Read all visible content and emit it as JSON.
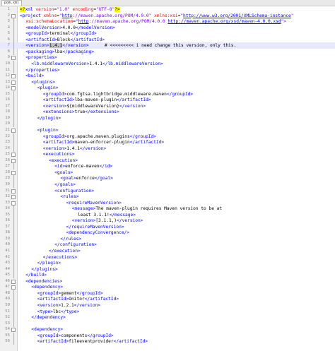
{
  "tab": {
    "label": "pom.xml"
  },
  "lines": [
    {
      "n": "1",
      "indent": 0,
      "fold": "none",
      "parts": [
        [
          "decl",
          "<?"
        ],
        [
          "t",
          "xml"
        ],
        [
          "a",
          " version"
        ],
        [
          "c",
          "="
        ],
        [
          "v",
          "\"1.0\""
        ],
        [
          "a",
          " encoding"
        ],
        [
          "c",
          "="
        ],
        [
          "v",
          "\"UTF-8\""
        ],
        [
          "decl",
          "?>"
        ]
      ]
    },
    {
      "n": "2",
      "indent": 0,
      "fold": "box",
      "parts": [
        [
          "t",
          "<project"
        ],
        [
          "a",
          " xmlns"
        ],
        [
          "c",
          "="
        ],
        [
          "v",
          "\""
        ],
        [
          "u",
          "http"
        ],
        [
          "v",
          "://maven.apache.org/POM/4.0.0\""
        ],
        [
          "a",
          " xmlns:xsi"
        ],
        [
          "c",
          "="
        ],
        [
          "v",
          "\""
        ],
        [
          "u",
          "http://www.w3.org/2001/XMLSchema-instance"
        ],
        [
          "v",
          "\""
        ]
      ]
    },
    {
      "n": "3",
      "indent": 1,
      "fold": "vl",
      "parts": [
        [
          "a",
          "xsi:schemaLocation"
        ],
        [
          "c",
          "="
        ],
        [
          "v",
          "\""
        ],
        [
          "u",
          "http"
        ],
        [
          "v",
          "://maven.apache.org/POM/4.0.0 "
        ],
        [
          "u",
          "http://maven.apache.org/xsd/maven-4.0.0.xsd"
        ],
        [
          "v",
          "\">"
        ]
      ]
    },
    {
      "n": "4",
      "indent": 1,
      "fold": "vl",
      "parts": [
        [
          "t",
          "<modelVersion>"
        ],
        [
          "c",
          "4.0.0"
        ],
        [
          "t",
          "</modelVersion>"
        ]
      ]
    },
    {
      "n": "5",
      "indent": 1,
      "fold": "vl",
      "parts": [
        [
          "t",
          "<groupId>"
        ],
        [
          "c",
          "terminal"
        ],
        [
          "t",
          "</groupId>"
        ]
      ]
    },
    {
      "n": "6",
      "indent": 1,
      "fold": "vl",
      "parts": [
        [
          "t",
          "<artifactId>"
        ],
        [
          "c",
          "Block"
        ],
        [
          "t",
          "</artifactId>"
        ]
      ]
    },
    {
      "n": "7",
      "indent": 1,
      "fold": "vl",
      "hl": true,
      "parts": [
        [
          "t",
          "<version>"
        ],
        [
          "sel",
          "1.4.1"
        ],
        [
          "t",
          "</version>"
        ],
        [
          "c",
          "      # <<<<<<<<< i need change this version, only this."
        ]
      ]
    },
    {
      "n": "8",
      "indent": 1,
      "fold": "vl",
      "parts": [
        [
          "t",
          "<packaging>"
        ],
        [
          "c",
          "lba"
        ],
        [
          "t",
          "</packaging>"
        ]
      ]
    },
    {
      "n": "9",
      "indent": 1,
      "fold": "box",
      "parts": [
        [
          "t",
          "<properties>"
        ]
      ]
    },
    {
      "n": "10",
      "indent": 2,
      "fold": "vl",
      "parts": [
        [
          "t",
          "<lb.middlewareVersion>"
        ],
        [
          "c",
          "1.4.1"
        ],
        [
          "t",
          "</lb.middlewareVersion>"
        ]
      ]
    },
    {
      "n": "11",
      "indent": 1,
      "fold": "vl",
      "parts": [
        [
          "t",
          "</properties>"
        ]
      ]
    },
    {
      "n": "12",
      "indent": 1,
      "fold": "box",
      "parts": [
        [
          "t",
          "<build>"
        ]
      ]
    },
    {
      "n": "13",
      "indent": 2,
      "fold": "box",
      "parts": [
        [
          "t",
          "<plugins>"
        ]
      ]
    },
    {
      "n": "14",
      "indent": 3,
      "fold": "box",
      "parts": [
        [
          "t",
          "<plugin>"
        ]
      ]
    },
    {
      "n": "15",
      "indent": 4,
      "fold": "vl",
      "parts": [
        [
          "t",
          "<groupId>"
        ],
        [
          "c",
          "com.fgtsa.lightbridge.middleware.maven"
        ],
        [
          "t",
          "</groupId>"
        ]
      ]
    },
    {
      "n": "16",
      "indent": 4,
      "fold": "vl",
      "parts": [
        [
          "t",
          "<artifactId>"
        ],
        [
          "c",
          "lba-maven-plugin"
        ],
        [
          "t",
          "</artifactId>"
        ]
      ]
    },
    {
      "n": "17",
      "indent": 4,
      "fold": "vl",
      "parts": [
        [
          "t",
          "<version>"
        ],
        [
          "c",
          "${middlewareVersion}"
        ],
        [
          "t",
          "</version>"
        ]
      ]
    },
    {
      "n": "18",
      "indent": 4,
      "fold": "vl",
      "parts": [
        [
          "t",
          "<extensions>"
        ],
        [
          "c",
          "true"
        ],
        [
          "t",
          "</extensions>"
        ]
      ]
    },
    {
      "n": "19",
      "indent": 3,
      "fold": "vl",
      "parts": [
        [
          "t",
          "</plugin>"
        ]
      ]
    },
    {
      "n": "20",
      "indent": 0,
      "fold": "vl",
      "parts": []
    },
    {
      "n": "21",
      "indent": 3,
      "fold": "box",
      "parts": [
        [
          "t",
          "<plugin>"
        ]
      ]
    },
    {
      "n": "22",
      "indent": 4,
      "fold": "vl",
      "parts": [
        [
          "t",
          "<groupId>"
        ],
        [
          "c",
          "org.apache.maven.plugins"
        ],
        [
          "t",
          "</groupId>"
        ]
      ]
    },
    {
      "n": "23",
      "indent": 4,
      "fold": "vl",
      "parts": [
        [
          "t",
          "<artifactId>"
        ],
        [
          "c",
          "maven-enforcer-plugin"
        ],
        [
          "t",
          "</artifactId>"
        ]
      ]
    },
    {
      "n": "24",
      "indent": 4,
      "fold": "vl",
      "parts": [
        [
          "t",
          "<version>"
        ],
        [
          "c",
          "1.4.1"
        ],
        [
          "t",
          "</version>"
        ]
      ]
    },
    {
      "n": "25",
      "indent": 4,
      "fold": "box",
      "parts": [
        [
          "t",
          "<executions>"
        ]
      ]
    },
    {
      "n": "26",
      "indent": 5,
      "fold": "box",
      "parts": [
        [
          "t",
          "<execution>"
        ]
      ]
    },
    {
      "n": "27",
      "indent": 6,
      "fold": "vl",
      "parts": [
        [
          "t",
          "<id>"
        ],
        [
          "c",
          "enforce-maven"
        ],
        [
          "t",
          "</id>"
        ]
      ]
    },
    {
      "n": "28",
      "indent": 6,
      "fold": "box",
      "parts": [
        [
          "t",
          "<goals>"
        ]
      ]
    },
    {
      "n": "29",
      "indent": 7,
      "fold": "vl",
      "parts": [
        [
          "t",
          "<goal>"
        ],
        [
          "c",
          "enforce"
        ],
        [
          "t",
          "</goal>"
        ]
      ]
    },
    {
      "n": "30",
      "indent": 6,
      "fold": "vl",
      "parts": [
        [
          "t",
          "</goals>"
        ]
      ]
    },
    {
      "n": "31",
      "indent": 6,
      "fold": "box",
      "parts": [
        [
          "t",
          "<configuration>"
        ]
      ]
    },
    {
      "n": "32",
      "indent": 7,
      "fold": "box",
      "parts": [
        [
          "t",
          "<rules>"
        ]
      ]
    },
    {
      "n": "33",
      "indent": 8,
      "fold": "box",
      "parts": [
        [
          "t",
          "<requireMavenVersion>"
        ]
      ]
    },
    {
      "n": "34",
      "indent": 9,
      "fold": "vl",
      "parts": [
        [
          "t",
          "<message>"
        ],
        [
          "c",
          "The maven-plugin requires Maven version to be at"
        ]
      ]
    },
    {
      "n": "35",
      "indent": 10,
      "fold": "vl",
      "parts": [
        [
          "c",
          "least 3.1.1!"
        ],
        [
          "t",
          "</message>"
        ]
      ]
    },
    {
      "n": "36",
      "indent": 9,
      "fold": "vl",
      "parts": [
        [
          "t",
          "<version>"
        ],
        [
          "c",
          "[3.1.1,)"
        ],
        [
          "t",
          "</version>"
        ]
      ]
    },
    {
      "n": "37",
      "indent": 8,
      "fold": "vl",
      "parts": [
        [
          "t",
          "</requireMavenVersion>"
        ]
      ]
    },
    {
      "n": "38",
      "indent": 8,
      "fold": "vl",
      "parts": [
        [
          "t",
          "<dependencyConvergence/>"
        ]
      ]
    },
    {
      "n": "39",
      "indent": 7,
      "fold": "vl",
      "parts": [
        [
          "t",
          "</rules>"
        ]
      ]
    },
    {
      "n": "40",
      "indent": 6,
      "fold": "vl",
      "parts": [
        [
          "t",
          "</configuration>"
        ]
      ]
    },
    {
      "n": "41",
      "indent": 5,
      "fold": "vl",
      "parts": [
        [
          "t",
          "</execution>"
        ]
      ]
    },
    {
      "n": "42",
      "indent": 4,
      "fold": "vl",
      "parts": [
        [
          "t",
          "</executions>"
        ]
      ]
    },
    {
      "n": "43",
      "indent": 3,
      "fold": "vl",
      "parts": [
        [
          "t",
          "</plugin>"
        ]
      ]
    },
    {
      "n": "44",
      "indent": 2,
      "fold": "vl",
      "parts": [
        [
          "t",
          "</plugins>"
        ]
      ]
    },
    {
      "n": "45",
      "indent": 1,
      "fold": "vl",
      "parts": [
        [
          "t",
          "</build>"
        ]
      ]
    },
    {
      "n": "46",
      "indent": 1,
      "fold": "box",
      "parts": [
        [
          "t",
          "<dependencies>"
        ]
      ]
    },
    {
      "n": "47",
      "indent": 2,
      "fold": "box",
      "parts": [
        [
          "t",
          "<dependency>"
        ]
      ]
    },
    {
      "n": "48",
      "indent": 3,
      "fold": "vl",
      "parts": [
        [
          "t",
          "<groupId>"
        ],
        [
          "c",
          "gement"
        ],
        [
          "t",
          "</groupId>"
        ]
      ]
    },
    {
      "n": "49",
      "indent": 3,
      "fold": "vl",
      "parts": [
        [
          "t",
          "<artifactId>"
        ],
        [
          "c",
          "Onitor"
        ],
        [
          "t",
          "</artifactId>"
        ]
      ]
    },
    {
      "n": "50",
      "indent": 3,
      "fold": "vl",
      "parts": [
        [
          "t",
          "<version>"
        ],
        [
          "c",
          "1.2.1"
        ],
        [
          "t",
          "</version>"
        ]
      ]
    },
    {
      "n": "51",
      "indent": 3,
      "fold": "vl",
      "parts": [
        [
          "t",
          "<type>"
        ],
        [
          "c",
          "lbc"
        ],
        [
          "t",
          "</type>"
        ]
      ]
    },
    {
      "n": "52",
      "indent": 2,
      "fold": "vl",
      "parts": [
        [
          "t",
          "</dependency>"
        ]
      ]
    },
    {
      "n": "53",
      "indent": 0,
      "fold": "vl",
      "parts": []
    },
    {
      "n": "54",
      "indent": 2,
      "fold": "box",
      "parts": [
        [
          "t",
          "<dependency>"
        ]
      ]
    },
    {
      "n": "55",
      "indent": 3,
      "fold": "vl",
      "parts": [
        [
          "t",
          "<groupId>"
        ],
        [
          "c",
          "components"
        ],
        [
          "t",
          "</groupId>"
        ]
      ]
    },
    {
      "n": "56",
      "indent": 3,
      "fold": "vl",
      "parts": [
        [
          "t",
          "<artifactId>"
        ],
        [
          "c",
          "fileeventprovider"
        ],
        [
          "t",
          "</artifactId>"
        ]
      ]
    }
  ]
}
